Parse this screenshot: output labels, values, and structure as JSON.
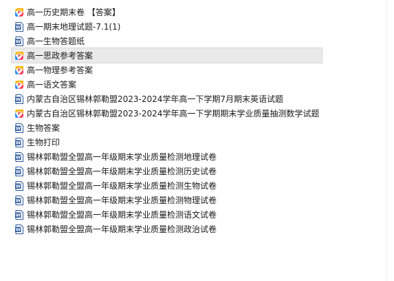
{
  "files": [
    {
      "name": "高一历史期末卷 【答案】",
      "type": "pdf"
    },
    {
      "name": "高一期末地理试题-7.1(1)",
      "type": "word"
    },
    {
      "name": "高一生物答题纸",
      "type": "word"
    },
    {
      "name": "高一思政参考答案",
      "type": "pdf",
      "selected": true
    },
    {
      "name": "高一物理参考答案",
      "type": "pdf"
    },
    {
      "name": "高一语文答案",
      "type": "pdf"
    },
    {
      "name": "内蒙古自治区锡林郭勒盟2023-2024学年高一下学期7月期末英语试题",
      "type": "word"
    },
    {
      "name": "内蒙古自治区锡林郭勒盟2023-2024学年高一下学期期末学业质量抽测数学试题",
      "type": "pdf"
    },
    {
      "name": "生物答案",
      "type": "word"
    },
    {
      "name": "生物打印",
      "type": "word"
    },
    {
      "name": "锡林郭勒盟全盟高一年级期末学业质量检测地理试卷",
      "type": "word"
    },
    {
      "name": "锡林郭勒盟全盟高一年级期末学业质量检测历史试卷",
      "type": "word"
    },
    {
      "name": "锡林郭勒盟全盟高一年级期末学业质量检测生物试卷",
      "type": "word"
    },
    {
      "name": "锡林郭勒盟全盟高一年级期末学业质量检测物理试卷",
      "type": "word"
    },
    {
      "name": "锡林郭勒盟全盟高一年级期末学业质量检测语文试卷",
      "type": "word"
    },
    {
      "name": "锡林郭勒盟全盟高一年级期末学业质量检测政治试卷",
      "type": "word"
    }
  ],
  "icons": {
    "pdf": "pdf-file-icon",
    "word": "word-document-icon"
  },
  "colors": {
    "word_blue": "#2b579a",
    "selected_bg": "#eaeaea"
  }
}
